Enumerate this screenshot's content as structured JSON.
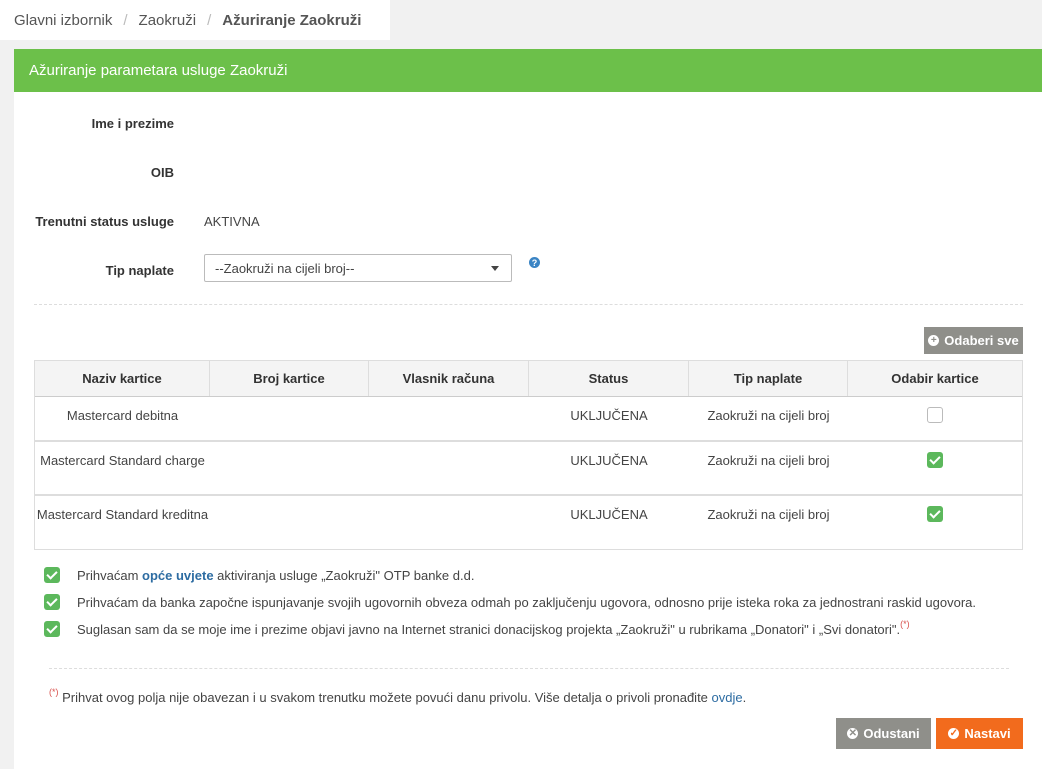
{
  "breadcrumb": {
    "items": [
      "Glavni izbornik",
      "Zaokruži"
    ],
    "current": "Ažuriranje Zaokruži",
    "separator": "/"
  },
  "panel": {
    "title": "Ažuriranje parametara usluge Zaokruži",
    "header_color": "#6cc04a"
  },
  "form": {
    "name_label": "Ime i prezime",
    "name_value": "",
    "oib_label": "OIB",
    "oib_value": "",
    "status_label": "Trenutni status usluge",
    "status_value": "AKTIVNA",
    "payment_label": "Tip naplate",
    "payment_selected": "--Zaokruži na cijeli broj--",
    "help_icon": "?"
  },
  "select_all": {
    "label": "Odaberi sve",
    "icon": "+"
  },
  "table": {
    "headers": [
      "Naziv kartice",
      "Broj kartice",
      "Vlasnik računa",
      "Status",
      "Tip naplate",
      "Odabir kartice"
    ],
    "rows": [
      {
        "name": "Mastercard debitna",
        "number": "",
        "owner": "",
        "status": "UKLJUČENA",
        "payment": "Zaokruži na cijeli broj",
        "selected": false
      },
      {
        "name": "Mastercard Standard charge",
        "number": "",
        "owner": "",
        "status": "UKLJUČENA",
        "payment": "Zaokruži na cijeli broj",
        "selected": true
      },
      {
        "name": "Mastercard Standard kreditna",
        "number": "",
        "owner": "",
        "status": "UKLJUČENA",
        "payment": "Zaokruži na cijeli broj",
        "selected": true
      }
    ]
  },
  "consents": {
    "c1": {
      "before": "Prihvaćam ",
      "link": "opće uvjete",
      "after": " aktiviranja usluge „Zaokruži\" OTP banke d.d.",
      "checked": true
    },
    "c2": {
      "text": "Prihvaćam da banka započne ispunjavanje svojih ugovornih obveza odmah po zaključenju ugovora, odnosno prije isteka roka za jednostrani raskid ugovora.",
      "checked": true
    },
    "c3": {
      "text": "Suglasan sam da se moje ime i prezime objavi javno na Internet stranici donacijskog projekta „Zaokruži\" u rubrikama „Donatori\" i „Svi donatori\".",
      "mark": "(*)",
      "checked": true
    }
  },
  "footnote": {
    "mark": "(*)",
    "text": " Prihvat ovog polja nije obavezan i u svakom trenutku možete povući danu privolu. Više detalja o privoli pronađite ",
    "link": "ovdje",
    "end": "."
  },
  "actions": {
    "cancel_label": "Odustani",
    "submit_label": "Nastavi",
    "cancel_color": "#8f8f8a",
    "submit_color": "#f26b1d"
  }
}
